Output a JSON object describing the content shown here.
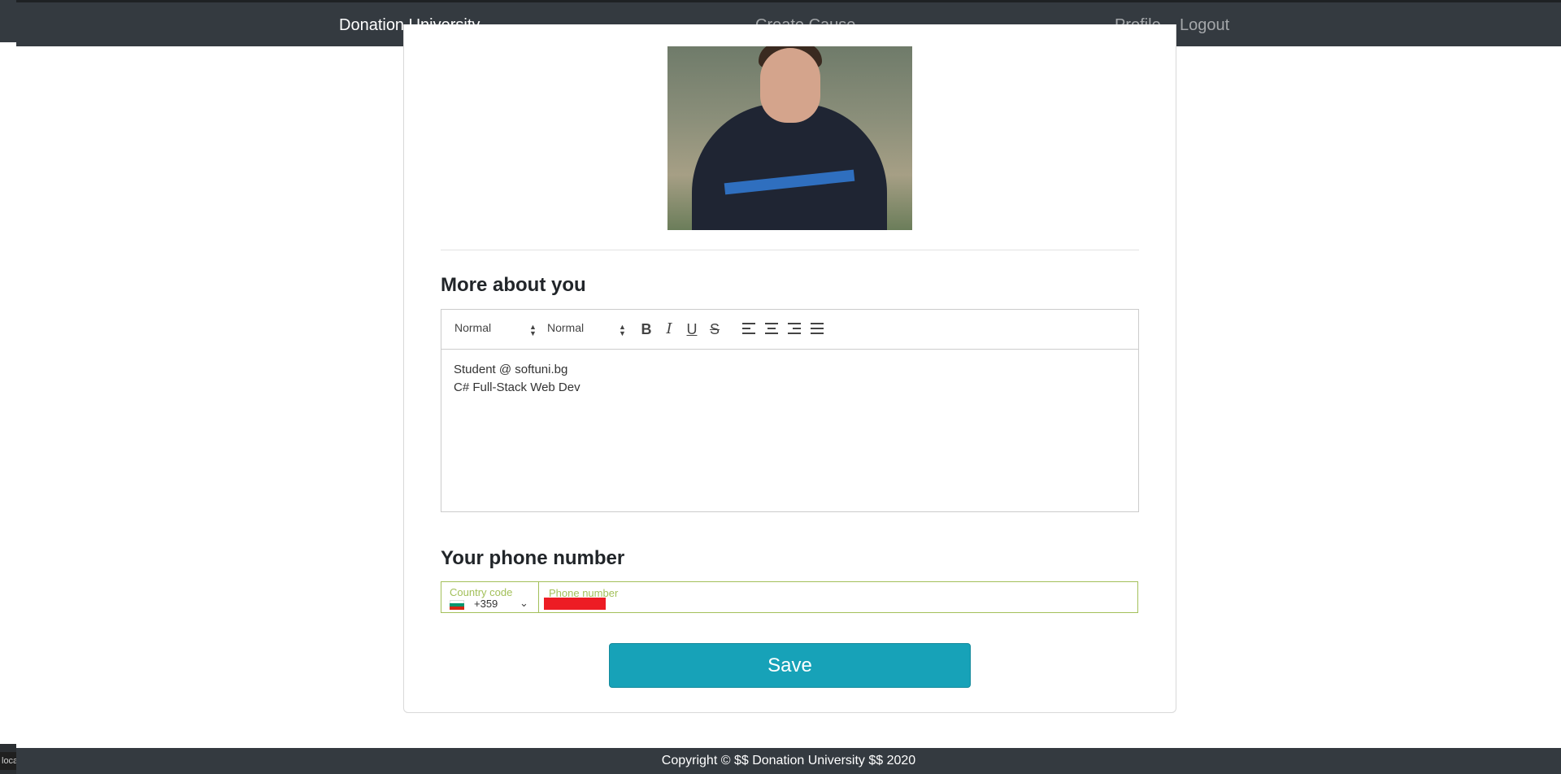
{
  "navbar": {
    "brand": "Donation University",
    "create_cause": "Create Cause",
    "profile": "Profile",
    "logout": "Logout"
  },
  "about": {
    "title": "More about you",
    "toolbar": {
      "size_picker": "Normal",
      "header_picker": "Normal"
    },
    "content_lines": [
      "Student @ softuni.bg",
      "C# Full-Stack Web Dev"
    ]
  },
  "phone": {
    "title": "Your phone number",
    "country_label": "Country code",
    "country_code": "+359",
    "number_label": "Phone number",
    "flag_colors": [
      "#ffffff",
      "#00966e",
      "#d62612"
    ],
    "redaction_color": "#ed1c24"
  },
  "save_label": "Save",
  "footer": "Copyright © $$ Donation University $$ 2020",
  "status_hint": "loca",
  "colors": {
    "navbar": "#343a40",
    "accent_button": "#17a2b8",
    "input_border": "#a3c05a"
  }
}
